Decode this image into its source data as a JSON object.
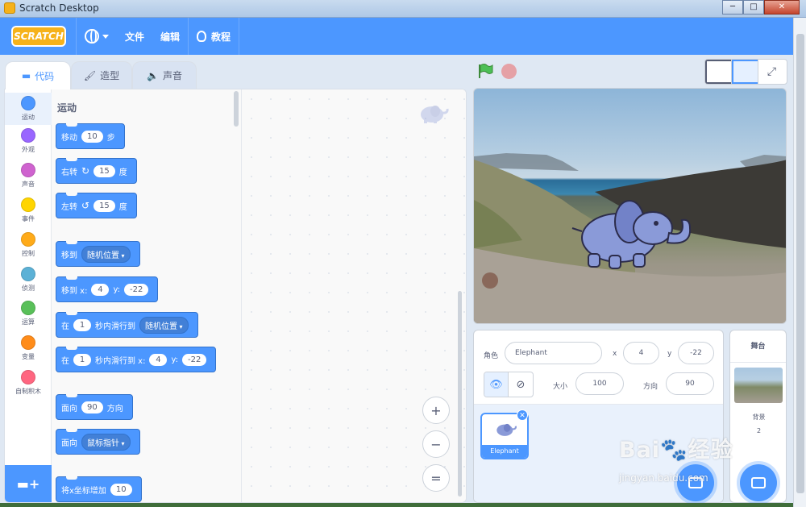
{
  "window": {
    "title": "Scratch Desktop",
    "buttons": [
      "─",
      "□",
      "✕"
    ]
  },
  "menubar": {
    "logo": "SCRATCH",
    "items": [
      "文件",
      "编辑"
    ],
    "tutorial": "教程"
  },
  "tabs": [
    {
      "label": "代码",
      "icon": "code-icon"
    },
    {
      "label": "造型",
      "icon": "brush-icon"
    },
    {
      "label": "声音",
      "icon": "speaker-icon"
    }
  ],
  "categories": [
    {
      "label": "运动",
      "color": "#4c97ff"
    },
    {
      "label": "外观",
      "color": "#9966ff"
    },
    {
      "label": "声音",
      "color": "#cf63cf"
    },
    {
      "label": "事件",
      "color": "#ffd500"
    },
    {
      "label": "控制",
      "color": "#ffab19"
    },
    {
      "label": "侦测",
      "color": "#5cb1d6"
    },
    {
      "label": "运算",
      "color": "#59c059"
    },
    {
      "label": "变量",
      "color": "#ff8c1a"
    },
    {
      "label": "自制积木",
      "color": "#ff6680"
    }
  ],
  "palette": {
    "section_title": "运动",
    "blocks": {
      "move": {
        "pre": "移动",
        "value": "10",
        "post": "步"
      },
      "turn_right": {
        "pre": "右转",
        "value": "15",
        "post": "度"
      },
      "turn_left": {
        "pre": "左转",
        "value": "15",
        "post": "度"
      },
      "goto": {
        "pre": "移到",
        "dropdown": "随机位置"
      },
      "goto_xy": {
        "pre": "移到 x:",
        "x": "4",
        "ylabel": "y:",
        "y": "-22"
      },
      "glide": {
        "pre": "在",
        "secs": "1",
        "mid": "秒内滑行到",
        "dropdown": "随机位置"
      },
      "glide_xy": {
        "pre": "在",
        "secs": "1",
        "mid": "秒内滑行到 x:",
        "x": "4",
        "ylabel": "y:",
        "y": "-22"
      },
      "point_dir": {
        "pre": "面向",
        "value": "90",
        "post": "方向"
      },
      "point_towards": {
        "pre": "面向",
        "dropdown": "鼠标指针"
      },
      "change_x": {
        "pre": "将x坐标增加",
        "value": "10"
      }
    }
  },
  "workspace": {
    "zoom_in": "+",
    "zoom_out": "−",
    "zoom_reset": "="
  },
  "sprite_info": {
    "sprite_label": "角色",
    "sprite_name": "Elephant",
    "x_label": "x",
    "x": "4",
    "y_label": "y",
    "y": "-22",
    "size_label": "大小",
    "size": "100",
    "direction_label": "方向",
    "direction": "90"
  },
  "sprites": [
    {
      "name": "Elephant"
    }
  ],
  "stage_pane": {
    "title": "舞台",
    "backdrop_label": "背景",
    "backdrop_count": "2"
  },
  "watermark": {
    "logo": "Bai🐾经验",
    "url": "jingyan.baidu.com"
  }
}
